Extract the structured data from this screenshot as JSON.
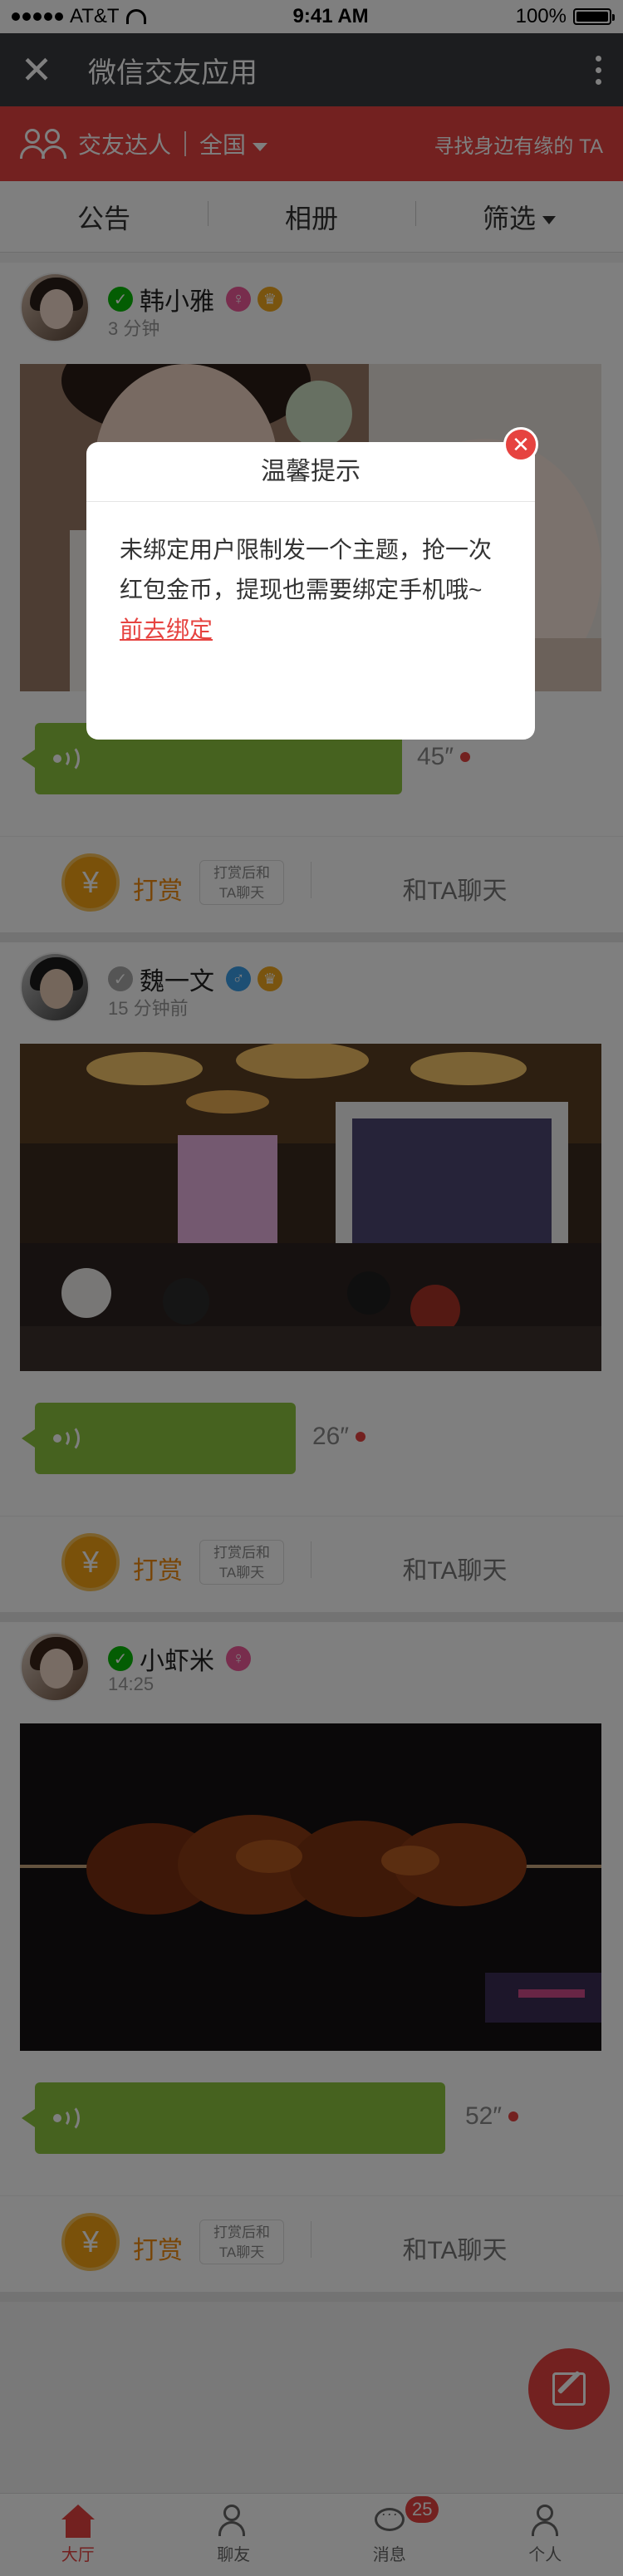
{
  "status_bar": {
    "carrier": "AT&T",
    "time": "9:41 AM",
    "battery": "100%"
  },
  "header": {
    "title": "微信交友应用"
  },
  "filter_bar": {
    "label": "交友达人",
    "region": "全国",
    "slogan": "寻找身边有缘的 TA"
  },
  "tabs": [
    {
      "label": "公告"
    },
    {
      "label": "相册"
    },
    {
      "label": "筛选"
    }
  ],
  "posts": [
    {
      "name": "韩小雅",
      "time": "3 分钟",
      "duration": "45″",
      "tip_label": "打赏",
      "tip_note_1": "打赏后和",
      "tip_note_2": "TA聊天",
      "chat": "和TA聊天"
    },
    {
      "name": "魏一文",
      "time": "15 分钟前",
      "duration": "26″",
      "tip_label": "打赏",
      "tip_note_1": "打赏后和",
      "tip_note_2": "TA聊天",
      "chat": "和TA聊天"
    },
    {
      "name": "小虾米",
      "time": "14:25",
      "duration": "52″",
      "tip_label": "打赏",
      "tip_note_1": "打赏后和",
      "tip_note_2": "TA聊天",
      "chat": "和TA聊天"
    }
  ],
  "dialog": {
    "title": "温馨提示",
    "message": "未绑定用户限制发一个主题，抢一次红包金币，提现也需要绑定手机哦~",
    "link": "前去绑定"
  },
  "bottom_nav": [
    {
      "label": "大厅"
    },
    {
      "label": "聊友"
    },
    {
      "label": "消息"
    },
    {
      "label": "个人"
    }
  ],
  "badge": "25",
  "colors": {
    "accent": "#e64340",
    "voice": "#8dc43f",
    "coin": "#f4a215"
  }
}
